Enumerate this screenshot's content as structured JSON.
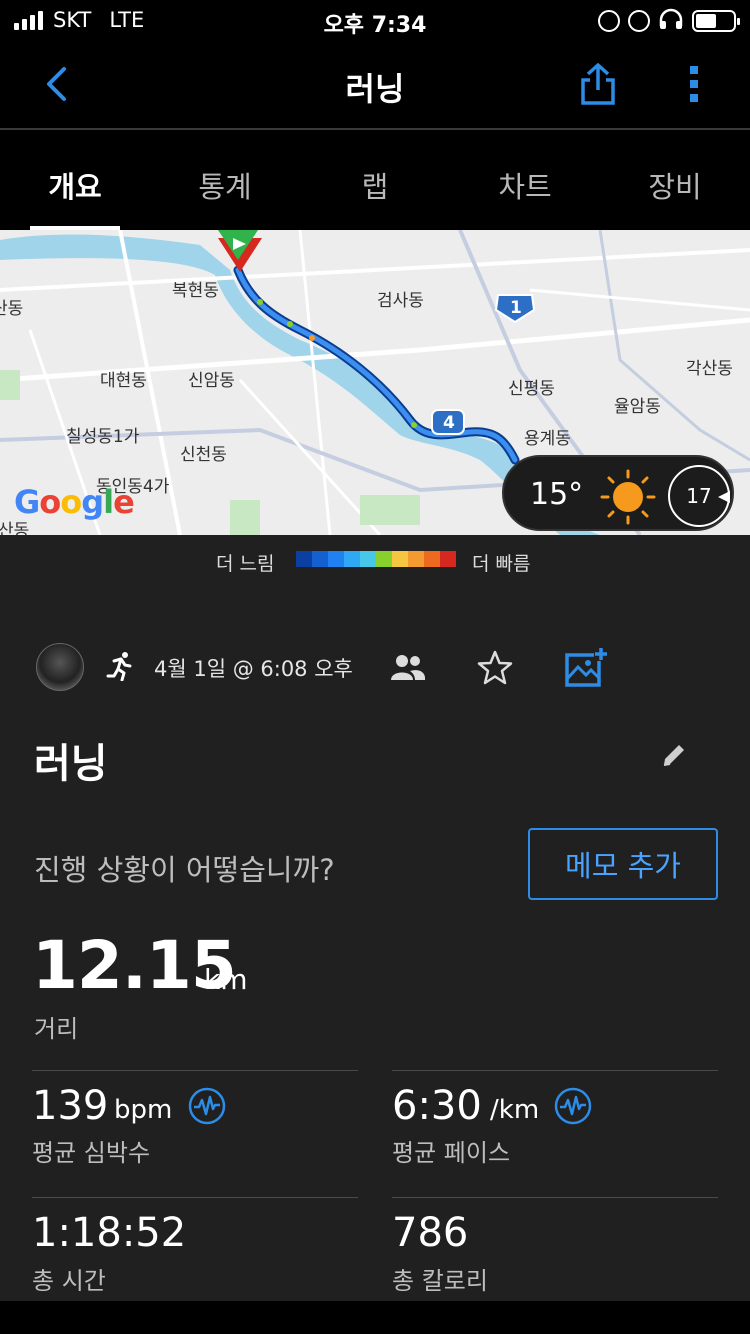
{
  "status_bar": {
    "carrier": "SKT",
    "network": "LTE",
    "time": "오후 7:34"
  },
  "nav": {
    "title": "러닝",
    "back_icon": "chevron-left-icon",
    "share_icon": "share-icon",
    "more_icon": "more-vertical-icon"
  },
  "tabs": [
    {
      "label": "개요",
      "active": true
    },
    {
      "label": "통계",
      "active": false
    },
    {
      "label": "랩",
      "active": false
    },
    {
      "label": "차트",
      "active": false
    },
    {
      "label": "장비",
      "active": false
    }
  ],
  "map": {
    "labels": [
      "복현동",
      "검사동",
      "대현동",
      "신암동",
      "신평동",
      "각산동",
      "율암동",
      "칠성동1가",
      "신천동",
      "용계동",
      "동인동4가",
      "산동",
      "산동"
    ],
    "route_shields": [
      "1",
      "4"
    ],
    "google_logo": "Google",
    "weather": {
      "temperature": "15°",
      "wind": "17"
    }
  },
  "pace_legend": {
    "slow_label": "더 느림",
    "fast_label": "더 빠름",
    "colors": [
      "#0b3fa0",
      "#1460d0",
      "#1f82f0",
      "#2fa8f5",
      "#46c9e8",
      "#8ad02c",
      "#f6c640",
      "#f39a30",
      "#ee6a1e",
      "#d6281e"
    ]
  },
  "activity": {
    "date_time": "4월 1일 @ 6:08 오후",
    "title": "러닝",
    "question": "진행 상황이 어떻습니까?",
    "memo_button": "메모 추가",
    "distance": {
      "value": "12.15",
      "unit": "km",
      "label": "거리"
    },
    "stats": [
      {
        "value": "139",
        "unit": "bpm",
        "label": "평균 심박수",
        "icon": "heart-rate-icon"
      },
      {
        "value": "6:30",
        "unit": "/km",
        "label": "평균 페이스",
        "icon": "heart-rate-icon"
      },
      {
        "value": "1:18:52",
        "unit": "",
        "label": "총 시간"
      },
      {
        "value": "786",
        "unit": "",
        "label": "총 칼로리"
      }
    ]
  },
  "colors": {
    "accent": "#2d8ce6",
    "background": "#202020",
    "header": "#000000"
  }
}
